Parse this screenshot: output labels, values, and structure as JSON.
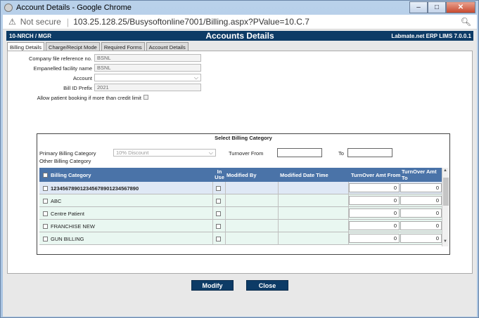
{
  "window": {
    "title": "Account Details - Google Chrome",
    "minimize": "–",
    "maximize": "□",
    "close": "✕"
  },
  "address_bar": {
    "security_label": "Not secure",
    "url": "103.25.128.25/Busysoftonline7001/Billing.aspx?PValue=10.C.7"
  },
  "header": {
    "left": "10-NRCH / MGR",
    "title": "Accounts Details",
    "right": "Labmate.net ERP LIMS 7.0.0.1"
  },
  "tabs": [
    {
      "label": "Billing Details",
      "active": true
    },
    {
      "label": "Charge/Recipt Mode",
      "active": false
    },
    {
      "label": "Required Forms",
      "active": false
    },
    {
      "label": "Account Details",
      "active": false
    }
  ],
  "form": {
    "company_ref_label": "Company file reference no.",
    "company_ref_value": "BSNL",
    "empanelled_label": "Empanelled facility name",
    "empanelled_value": "BSNL",
    "account_label": "Account",
    "account_value": "",
    "bill_prefix_label": "Bill ID Prefix",
    "bill_prefix_value": "2021",
    "allow_booking_label": "Allow patient booking if more than credit limit"
  },
  "billing_panel": {
    "title": "Select Billing Category",
    "primary_label": "Primary Billing Category",
    "primary_value": "10% Discount",
    "other_label": "Other Billing Category",
    "turnover_from_label": "Turnover From",
    "to_label": "To"
  },
  "table": {
    "headers": {
      "category": "Billing Category",
      "in_use": "In Use",
      "modified_by": "Modified By",
      "modified_date": "Modified Date Time",
      "amt_from": "TurnOver Amt From",
      "amt_to": "TurnOver Amt To"
    },
    "rows": [
      {
        "category": "123456789012345678901234567890",
        "from": "0",
        "to": "0",
        "bold": true
      },
      {
        "category": "ABC",
        "from": "0",
        "to": "0"
      },
      {
        "category": "Centre Patient",
        "from": "0",
        "to": "0"
      },
      {
        "category": "FRANCHISE NEW",
        "from": "0",
        "to": "0"
      },
      {
        "category": "GUN BILLING",
        "from": "0",
        "to": "0"
      }
    ]
  },
  "buttons": {
    "modify": "Modify",
    "close": "Close"
  },
  "colors": {
    "header_bg": "#0d3b66",
    "grid_header_bg": "#4a73a8",
    "row_bg": "#e9f7f1",
    "row_selected_bg": "#dfe8f5"
  }
}
